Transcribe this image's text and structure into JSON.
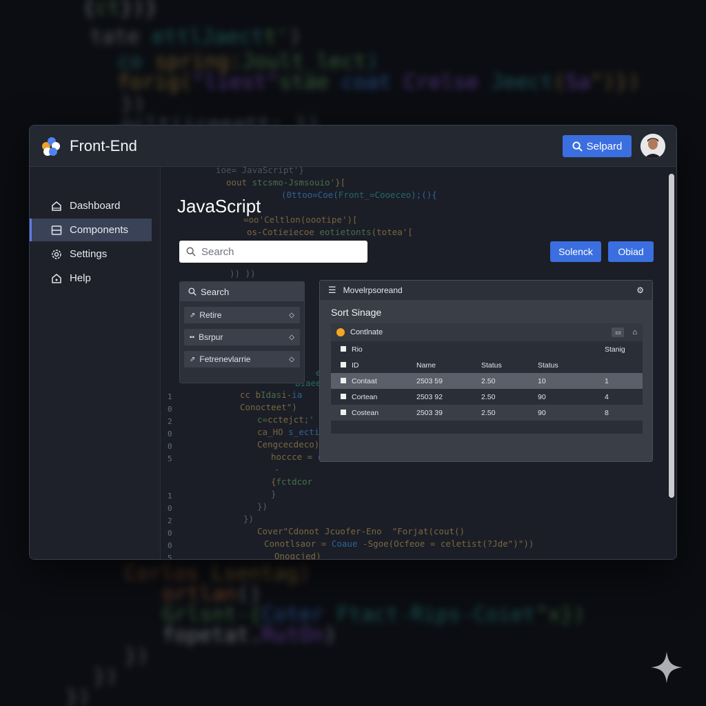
{
  "app": {
    "title": "Front-End",
    "top_button": "Selpard"
  },
  "sidebar": {
    "items": [
      {
        "label": "Dashboard",
        "icon": "home-icon"
      },
      {
        "label": "Components",
        "icon": "components-icon",
        "active": true
      },
      {
        "label": "Settings",
        "icon": "gear-icon"
      },
      {
        "label": "Help",
        "icon": "help-icon"
      }
    ]
  },
  "main": {
    "title": "JavaScript",
    "search_placeholder": "Search",
    "button_1": "Solenck",
    "button_2": "Obiad",
    "side_panel": {
      "search_label": "Search",
      "items": [
        "Retire",
        "Bsrpur",
        "Fetrenevlarrie"
      ]
    },
    "table_panel": {
      "header": "Movelrpsoreand",
      "title": "Sort Sinage",
      "card_label": "Contlnate",
      "columns_row1": [
        "Rio",
        "",
        "",
        "",
        "Stanig"
      ],
      "columns_row2": [
        "ID",
        "Name",
        "Status",
        "Status",
        ""
      ],
      "rows": [
        [
          "Contaat",
          "2503 59",
          "2.50",
          "10",
          "1"
        ],
        [
          "Cortean",
          "2503 92",
          "2.50",
          "90",
          "4"
        ],
        [
          "Costean",
          "2503 39",
          "2.50",
          "90",
          "8"
        ]
      ]
    }
  },
  "colors": {
    "accent": "#3b6fe0",
    "background": "#0b0d12",
    "window": "#1b1e26"
  }
}
